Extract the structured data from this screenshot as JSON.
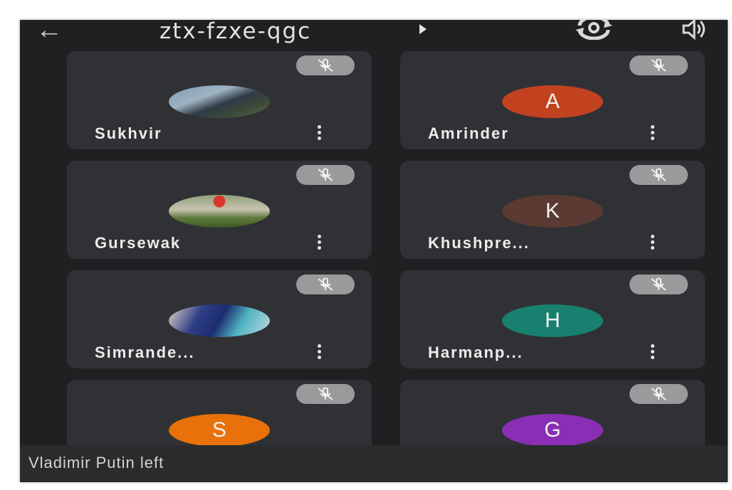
{
  "header": {
    "back_icon": "arrow-left-icon",
    "meeting_code": "ztx-fzxe-qgc",
    "camera_switch_icon": "switch-camera-icon",
    "speaker_icon": "speaker-icon"
  },
  "participants": [
    {
      "name": "Sukhvir",
      "avatar_type": "photo",
      "muted": true
    },
    {
      "name": "Amrinder",
      "avatar_type": "initial",
      "initial": "A",
      "color": "#c2421f",
      "muted": true
    },
    {
      "name": "Gursewak",
      "avatar_type": "photo",
      "muted": true
    },
    {
      "name": "Khushpre...",
      "avatar_type": "initial",
      "initial": "K",
      "color": "#5a3a32",
      "muted": true
    },
    {
      "name": "Simrande...",
      "avatar_type": "photo",
      "muted": true
    },
    {
      "name": "Harmanp...",
      "avatar_type": "initial",
      "initial": "H",
      "color": "#17806e",
      "muted": true
    },
    {
      "name": "",
      "avatar_type": "initial",
      "initial": "S",
      "color": "#e8710a",
      "muted": true
    },
    {
      "name": "",
      "avatar_type": "initial",
      "initial": "G",
      "color": "#8a2fb5",
      "muted": true
    }
  ],
  "toast": {
    "message": "Vladimir Putin left"
  },
  "colors": {
    "background": "#1f2022",
    "tile": "#303134",
    "mute_badge": "#9a9a9c"
  }
}
